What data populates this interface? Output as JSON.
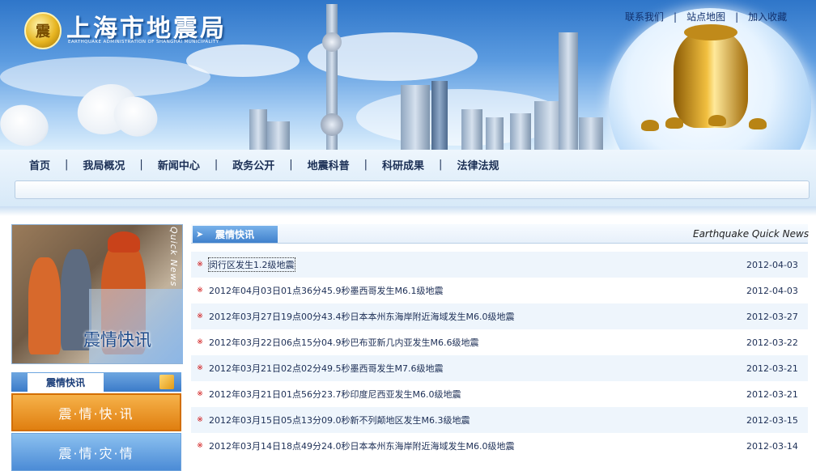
{
  "header": {
    "logo_glyph": "震",
    "title": "上海市地震局",
    "subtitle": "EARTHQUAKE ADMINISTRATION OF SHANGHAI MUNICIPALITY",
    "top_links": [
      "联系我们",
      "站点地图",
      "加入收藏"
    ]
  },
  "nav": {
    "items": [
      "首页",
      "我局概况",
      "新闻中心",
      "政务公开",
      "地震科普",
      "科研成果",
      "法律法规"
    ]
  },
  "sidebar": {
    "image_vertical_text": "Quick News",
    "image_caption": "震情快讯",
    "tab_label": "震情快讯",
    "buttons": [
      "震·情·快·讯",
      "震·情·灾·情"
    ]
  },
  "news": {
    "header_label": "震情快讯",
    "header_en": "Earthquake Quick News",
    "bullet": "※",
    "items": [
      {
        "title": "闵行区发生1.2级地震",
        "date": "2012-04-03"
      },
      {
        "title": "2012年04月03日01点36分45.9秒墨西哥发生M6.1级地震",
        "date": "2012-04-03"
      },
      {
        "title": "2012年03月27日19点00分43.4秒日本本州东海岸附近海域发生M6.0级地震",
        "date": "2012-03-27"
      },
      {
        "title": "2012年03月22日06点15分04.9秒巴布亚新几内亚发生M6.6级地震",
        "date": "2012-03-22"
      },
      {
        "title": "2012年03月21日02点02分49.5秒墨西哥发生M7.6级地震",
        "date": "2012-03-21"
      },
      {
        "title": "2012年03月21日01点56分23.7秒印度尼西亚发生M6.0级地震",
        "date": "2012-03-21"
      },
      {
        "title": "2012年03月15日05点13分09.0秒新不列颠地区发生M6.3级地震",
        "date": "2012-03-15"
      },
      {
        "title": "2012年03月14日18点49分24.0秒日本本州东海岸附近海域发生M6.0级地震",
        "date": "2012-03-14"
      }
    ]
  }
}
